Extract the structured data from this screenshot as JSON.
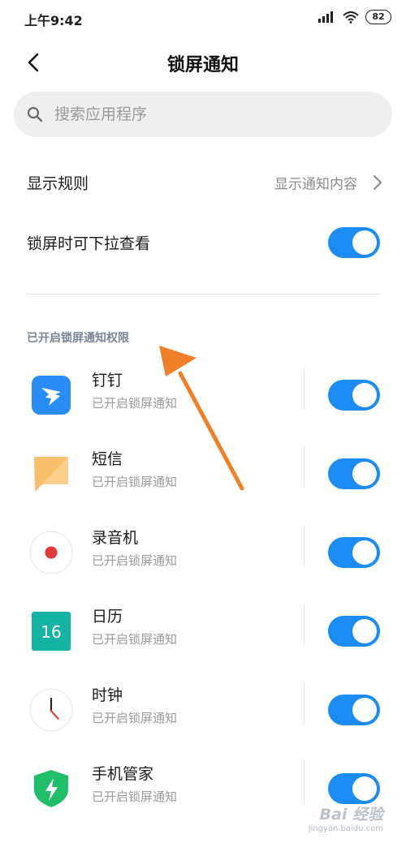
{
  "status_bar": {
    "time": "上午9:42",
    "battery": "82"
  },
  "header": {
    "title": "锁屏通知"
  },
  "search": {
    "placeholder": "搜索应用程序"
  },
  "settings": {
    "display_rule": {
      "label": "显示规则",
      "value": "显示通知内容"
    },
    "pull_down": {
      "label": "锁屏时可下拉查看",
      "enabled": true
    }
  },
  "section": {
    "header": "已开启锁屏通知权限"
  },
  "apps": [
    {
      "name": "钉钉",
      "subtitle": "已开启锁屏通知",
      "icon": "dingtalk-icon",
      "enabled": true
    },
    {
      "name": "短信",
      "subtitle": "已开启锁屏通知",
      "icon": "sms-icon",
      "enabled": true
    },
    {
      "name": "录音机",
      "subtitle": "已开启锁屏通知",
      "icon": "recorder-icon",
      "enabled": true
    },
    {
      "name": "日历",
      "subtitle": "已开启锁屏通知",
      "icon": "calendar-icon",
      "calendar_day": "16",
      "enabled": true
    },
    {
      "name": "时钟",
      "subtitle": "已开启锁屏通知",
      "icon": "clock-icon",
      "enabled": true
    },
    {
      "name": "手机管家",
      "subtitle": "已开启锁屏通知",
      "icon": "security-icon",
      "enabled": true
    }
  ],
  "colors": {
    "accent": "#1b8cf3",
    "annotation_arrow": "#f07f2a"
  },
  "watermark": {
    "main": "Bai 经验",
    "sub": "jingyan.baidu.com"
  }
}
